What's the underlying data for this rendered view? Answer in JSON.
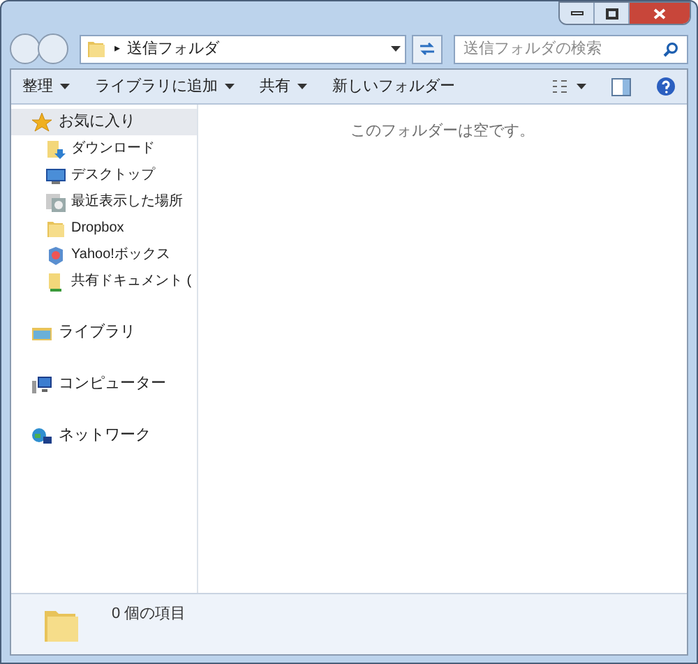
{
  "address_bar": {
    "separator": "▸",
    "path": "送信フォルダ"
  },
  "search": {
    "placeholder": "送信フォルダの検索"
  },
  "toolbar": {
    "items": [
      {
        "label": "整理",
        "dropdown": true
      },
      {
        "label": "ライブラリに追加",
        "dropdown": true
      },
      {
        "label": "共有",
        "dropdown": true
      },
      {
        "label": "新しいフォルダー",
        "dropdown": false
      }
    ]
  },
  "sidebar": {
    "groups": [
      {
        "label": "お気に入り",
        "selected": true,
        "children": [
          {
            "label": "ダウンロード"
          },
          {
            "label": "デスクトップ"
          },
          {
            "label": "最近表示した場所"
          },
          {
            "label": "Dropbox"
          },
          {
            "label": "Yahoo!ボックス"
          },
          {
            "label": "共有ドキュメント ("
          }
        ]
      },
      {
        "label": "ライブラリ",
        "selected": false
      },
      {
        "label": "コンピューター",
        "selected": false
      },
      {
        "label": "ネットワーク",
        "selected": false
      }
    ]
  },
  "content": {
    "empty_message": "このフォルダーは空です。"
  },
  "details_pane": {
    "item_count": "0 個の項目"
  }
}
